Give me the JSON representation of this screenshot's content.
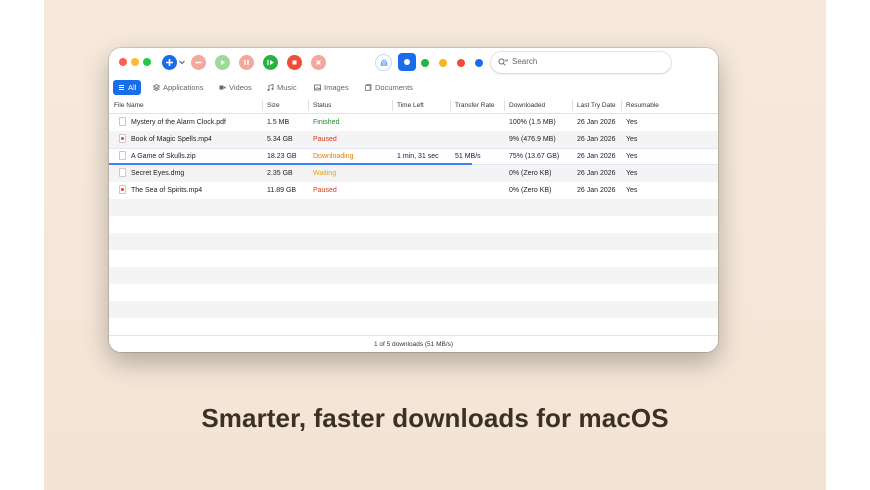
{
  "toolbar": {
    "buttons": [
      {
        "name": "add-download-icon",
        "color": "#1a6dea"
      },
      {
        "name": "remove-icon",
        "color": "#f3a79d"
      },
      {
        "name": "start-icon",
        "color": "#9fd89a"
      },
      {
        "name": "pause-icon",
        "color": "#f3a79d"
      },
      {
        "name": "resume-all-icon",
        "color": "#27b33f"
      },
      {
        "name": "stop-all-icon",
        "color": "#ef4c3a"
      },
      {
        "name": "cancel-icon",
        "color": "#f3a79d"
      }
    ],
    "color_filters": [
      "#1a6dea",
      "#27b33f",
      "#f5b521",
      "#ef4c3a",
      "#1a6dea"
    ],
    "search_placeholder": "Search"
  },
  "filters": [
    "All",
    "Applications",
    "Videos",
    "Music",
    "Images",
    "Documents"
  ],
  "columns": [
    "File Name",
    "Size",
    "Status",
    "Time Left",
    "Transfer Rate",
    "Downloaded",
    "Last Try Date",
    "Resumable"
  ],
  "rows": [
    {
      "name": "Mystery of the Alarm Clock.pdf",
      "size": "1.5 MB",
      "status": "Finished",
      "time_left": "",
      "rate": "",
      "downloaded": "100% (1.5 MB)",
      "date": "26 Jan 2026",
      "resumable": "Yes"
    },
    {
      "name": "Book of Magic Spells.mp4",
      "size": "5.34 GB",
      "status": "Paused",
      "time_left": "",
      "rate": "",
      "downloaded": "9% (476.9 MB)",
      "date": "26 Jan 2026",
      "resumable": "Yes"
    },
    {
      "name": "A Game of Skulls.zip",
      "size": "18.23 GB",
      "status": "Downloading",
      "time_left": "1 min, 31 sec",
      "rate": "51 MB/s",
      "downloaded": "75% (13.67 GB)",
      "date": "26 Jan 2026",
      "resumable": "Yes",
      "progress": 0.75
    },
    {
      "name": "Secret Eyes.dmg",
      "size": "2.35 GB",
      "status": "Waiting",
      "time_left": "",
      "rate": "",
      "downloaded": "0% (Zero KB)",
      "date": "26 Jan 2026",
      "resumable": "Yes"
    },
    {
      "name": "The Sea of Spirits.mp4",
      "size": "11.89 GB",
      "status": "Paused",
      "time_left": "",
      "rate": "",
      "downloaded": "0% (Zero KB)",
      "date": "26 Jan 2026",
      "resumable": "Yes"
    }
  ],
  "status_colors": {
    "Finished": "#1f8a2c",
    "Paused": "#d2401f",
    "Downloading": "#e07a17",
    "Waiting": "#e6a21a"
  },
  "status_bar": "1 of 5 downloads (51 MB/s)",
  "tagline": "Smarter, faster downloads for macOS"
}
